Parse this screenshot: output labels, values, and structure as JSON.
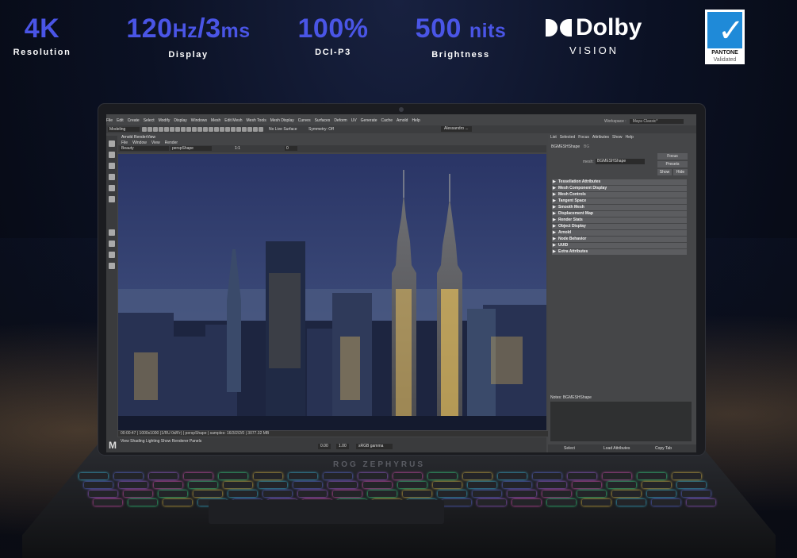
{
  "specs": [
    {
      "value_main": "4K",
      "value_small": "",
      "label": "Resolution"
    },
    {
      "value_main": "120",
      "value_small": "Hz",
      "value_main2": "/3",
      "value_small2": "ms",
      "label": "Display"
    },
    {
      "value_main": "100%",
      "value_small": "",
      "label": "DCI-P3"
    },
    {
      "value_main": "500 ",
      "value_small": "nits",
      "label": "Brightness"
    }
  ],
  "dolby": {
    "word": "Dolby",
    "sub": "VISION"
  },
  "pantone": {
    "line1": "PANTONE",
    "line2": "Validated"
  },
  "laptop_brand": "ROG ZEPHYRUS",
  "maya": {
    "menu": [
      "File",
      "Edit",
      "Create",
      "Select",
      "Modify",
      "Display",
      "Windows",
      "Mesh",
      "Edit Mesh",
      "Mesh Tools",
      "Mesh Display",
      "Curves",
      "Surfaces",
      "Deform",
      "UV",
      "Generate",
      "Cache",
      "Arnold",
      "Help"
    ],
    "workspace_label": "Workspace :",
    "workspace_value": "Maya Classic*",
    "mode": "Modeling",
    "no_live": "No Live Surface",
    "symmetry": "Symmetry: Off",
    "user": "Alessandro ...",
    "renderview": {
      "title": "Arnold RenderView",
      "menu": [
        "File",
        "Window",
        "View",
        "Render"
      ],
      "aov": "Beauty",
      "camera": "perspShape",
      "ratio": "1:1",
      "exposure": "0",
      "status": "00:00:47 | 1000x1000 (1/RU 0d/Fr) | perspShape | samples: 16/3/2/2/0 | 3077.32 MB"
    },
    "bottom": {
      "gamma": "sRGB gamma",
      "exposure": "0.00",
      "gamma_val": "1.00"
    },
    "attr": {
      "tabs": [
        "List",
        "Selected",
        "Focus",
        "Attributes",
        "Show",
        "Help"
      ],
      "node": "BGMESHShape",
      "node2": "BG",
      "mesh_label": "mesh:",
      "mesh_value": "BGMESHShape",
      "buttons": {
        "focus": "Focus",
        "presets": "Presets",
        "show": "Show",
        "hide": "Hide"
      },
      "sections": [
        "Tessellation Attributes",
        "Mesh Component Display",
        "Mesh Controls",
        "Tangent Space",
        "Smooth Mesh",
        "Displacement Map",
        "Render Stats",
        "Object Display",
        "Arnold",
        "Node Behavior",
        "UUID",
        "Extra Attributes"
      ],
      "notes": "Notes: BGMESHShape",
      "footer": [
        "Select",
        "Load Attributes",
        "Copy Tab"
      ]
    }
  }
}
